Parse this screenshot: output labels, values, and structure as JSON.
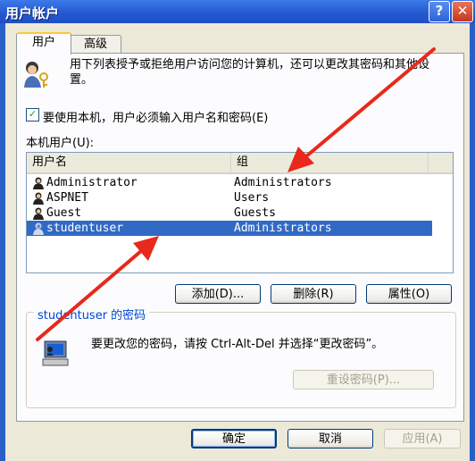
{
  "window": {
    "title": "用户帐户",
    "help_glyph": "?",
    "close_glyph": "✕"
  },
  "tabs": [
    {
      "label": "用户",
      "active": true
    },
    {
      "label": "高级",
      "active": false
    }
  ],
  "description": "用下列表授予或拒绝用户访问您的计算机，还可以更改其密码和其他设置。",
  "checkbox": {
    "label": "要使用本机，用户必须输入用户名和密码(E)",
    "checked": true
  },
  "users_list": {
    "label": "本机用户(U):",
    "columns": [
      "用户名",
      "组"
    ],
    "rows": [
      {
        "name": "Administrator",
        "group": "Administrators",
        "selected": false
      },
      {
        "name": "ASPNET",
        "group": "Users",
        "selected": false
      },
      {
        "name": "Guest",
        "group": "Guests",
        "selected": false
      },
      {
        "name": "studentuser",
        "group": "Administrators",
        "selected": true
      }
    ]
  },
  "list_buttons": {
    "add": "添加(D)...",
    "remove": "删除(R)",
    "properties": "属性(O)"
  },
  "password_group": {
    "title": "studentuser 的密码",
    "text": "要更改您的密码，请按 Ctrl-Alt-Del 并选择“更改密码”。",
    "reset_button": "重设密码(P)..."
  },
  "footer_buttons": {
    "ok": "确定",
    "cancel": "取消",
    "apply": "应用(A)"
  },
  "colors": {
    "titlebar": "#2457cf",
    "selection": "#316ac5",
    "arrow": "#e8291c"
  },
  "icons": [
    "users-icon",
    "user-icon",
    "password-icon",
    "help-icon",
    "close-icon"
  ]
}
